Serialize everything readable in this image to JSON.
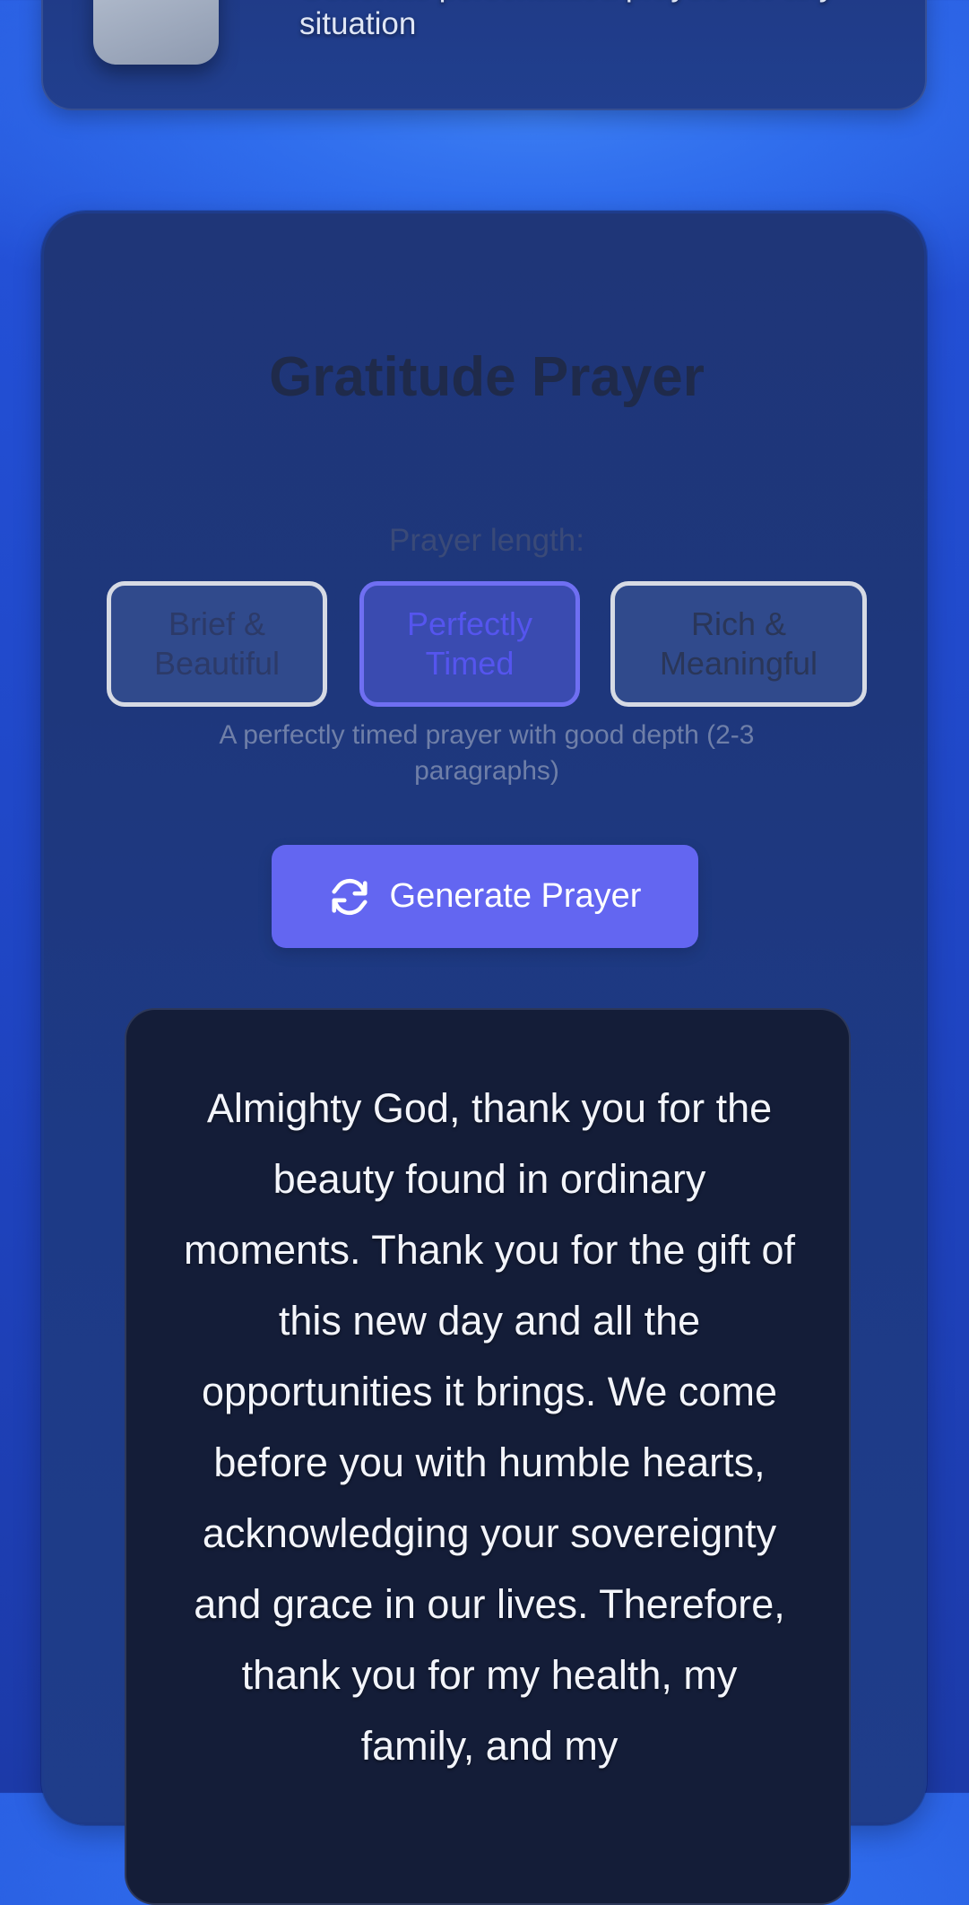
{
  "header": {
    "subtitle": "Generate personalized prayers for any situation",
    "icon": "praying-hands-icon"
  },
  "main": {
    "title": "Gratitude Prayer",
    "length_label": "Prayer length:",
    "length_options": [
      {
        "label": "Brief & Beautiful",
        "selected": false
      },
      {
        "label": "Perfectly Timed",
        "selected": true
      },
      {
        "label": "Rich & Meaningful",
        "selected": false
      }
    ],
    "length_description": "A perfectly timed prayer with good depth (2-3 paragraphs)",
    "generate_label": "Generate Prayer",
    "generate_icon": "refresh-icon",
    "prayer_text": "Almighty God, thank you for the beauty found in ordinary moments. Thank you for the gift of this new day and all the opportunities it brings. We come before you with humble hearts, acknowledging your sovereignty and grace in our lives. Therefore, thank you for my health, my family, and my"
  },
  "colors": {
    "accent": "#6366f1",
    "card": "#1f3678",
    "prayer_box": "#141d38"
  }
}
